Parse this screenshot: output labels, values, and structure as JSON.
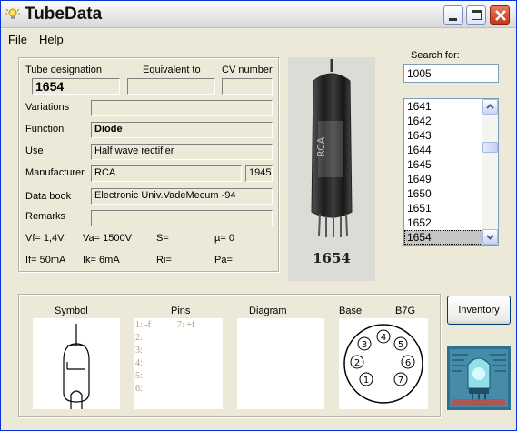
{
  "window": {
    "title": "TubeData"
  },
  "menu": [
    {
      "label": "File",
      "accel": "F",
      "rest": "ile"
    },
    {
      "label": "Help",
      "accel": "H",
      "rest": "elp"
    }
  ],
  "details": {
    "labels": {
      "tube_designation": "Tube designation",
      "equivalent_to": "Equivalent to",
      "cv_number": "CV number",
      "variations": "Variations",
      "function": "Function",
      "use": "Use",
      "manufacturer": "Manufacturer",
      "data_book": "Data book",
      "remarks": "Remarks"
    },
    "values": {
      "tube_designation": "1654",
      "equivalent_to": "",
      "cv_number": "",
      "variations": "",
      "function": "Diode",
      "use": "Half wave rectifier",
      "manufacturer": "RCA",
      "year": "1945",
      "data_book": "Electronic Univ.VadeMecum -94",
      "remarks": ""
    },
    "params": {
      "vf": "Vf= 1,4V",
      "va": "Va= 1500V",
      "s": "S=",
      "mu": "µ=   0",
      "if": "If= 50mA",
      "ik": "Ik=  6mA",
      "ri": "Ri=",
      "pa": "Pa="
    }
  },
  "image": {
    "caption": "1654"
  },
  "search": {
    "label": "Search for:",
    "value": "1005",
    "results": [
      "1641",
      "1642",
      "1643",
      "1644",
      "1645",
      "1649",
      "1650",
      "1651",
      "1652",
      "1654"
    ],
    "selected": "1654"
  },
  "bottom": {
    "labels": {
      "symbol": "Symbol",
      "pins": "Pins",
      "diagram": "Diagram",
      "base": "Base",
      "base_type": "B7G"
    },
    "pins": [
      "1: -f",
      "2:",
      "3:",
      "4:",
      "5:",
      "6:"
    ],
    "pin7": "7: +f",
    "base_pin_numbers": [
      "1",
      "2",
      "3",
      "4",
      "5",
      "6",
      "7"
    ]
  },
  "buttons": {
    "inventory": "Inventory"
  },
  "colors": {
    "title_bar": "#ffffff",
    "window_bg": "#ece9d8",
    "close_button": "#c8361a",
    "selection": "#c5c5c5"
  },
  "icons": [
    "lightbulb-icon",
    "minimize-icon",
    "maximize-icon",
    "close-icon",
    "scroll-up-icon",
    "scroll-down-icon"
  ]
}
